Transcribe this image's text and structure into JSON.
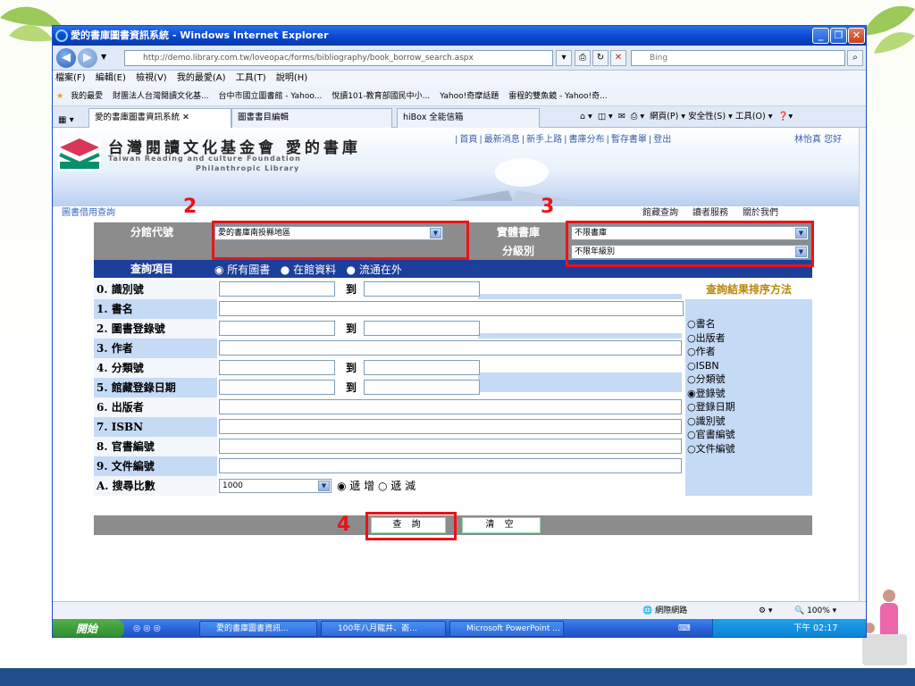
{
  "window": {
    "title": "愛的書庫圖書資訊系統 - Windows Internet Explorer"
  },
  "address": {
    "url": "http://demo.library.com.tw/loveopac/forms/bibliography/book_borrow_search.aspx",
    "search_placeholder": "Bing"
  },
  "menu": [
    "檔案(F)",
    "編輯(E)",
    "檢視(V)",
    "我的最愛(A)",
    "工具(T)",
    "說明(H)"
  ],
  "favorites": [
    "我的最愛",
    "財團法人台灣閱讀文化基...",
    "台中市國立圖書館 - Yahoo...",
    "悅讀101-教育部國民中小...",
    "Yahoo!奇摩話題",
    "雷程的雙魚鏡 - Yahoo!奇..."
  ],
  "tabs": {
    "active": "愛的書庫圖書資訊系統",
    "second": "圖書書目編輯",
    "third": "hiBox 全能信箱",
    "commands": "網頁(P) ▾  安全性(S) ▾  工具(O) ▾"
  },
  "site": {
    "logo_zh": "台灣閱讀文化基金會 愛的書庫",
    "logo_en1": "Taiwan Reading and culture Foundation",
    "logo_en2": "Philanthropic Library",
    "nav": [
      "首頁",
      "最新消息",
      "新手上路",
      "書庫分布",
      "暫存書單",
      "登出"
    ],
    "user": "林怡真 您好",
    "breadcrumb": "圖書借用查詢",
    "right_links": [
      "館藏查詢",
      "讀者服務",
      "關於我們"
    ]
  },
  "form": {
    "branch_label": "分館代號",
    "branch_value": "愛的書庫南投縣地區",
    "physical_label": "實體書庫",
    "physical_value": "不限書庫",
    "level_label": "分級別",
    "level_value": "不限年級別",
    "query_item_label": "查詢項目",
    "query_scope": [
      "所有圖書",
      "在館資料",
      "流通在外"
    ],
    "fields": [
      "0. 識別號",
      "1. 書名",
      "2. 圖書登錄號",
      "3. 作者",
      "4. 分類號",
      "5. 館藏登錄日期",
      "6. 出版者",
      "7. ISBN",
      "8. 官書編號",
      "9. 文件編號",
      "A. 搜尋比數"
    ],
    "to_label": "到",
    "count_value": "1000",
    "order": [
      "遞 增",
      "遞 減"
    ],
    "sort_title": "查詢結果排序方法",
    "sort_options": [
      "書名",
      "出版者",
      "作者",
      "ISBN",
      "分類號",
      "登錄號",
      "登錄日期",
      "識別號",
      "官書編號",
      "文件編號"
    ],
    "search_button": "查 詢",
    "clear_button": "清 空"
  },
  "steps": [
    "2",
    "3",
    "4"
  ],
  "status": {
    "zone": "網際網路",
    "zoom": "100%"
  },
  "taskbar": {
    "start": "開始",
    "tasks": [
      "愛的書庫圖書資訊...",
      "100年八月龍井、嵛...",
      "Microsoft PowerPoint ..."
    ],
    "clock": "下午 02:17"
  }
}
